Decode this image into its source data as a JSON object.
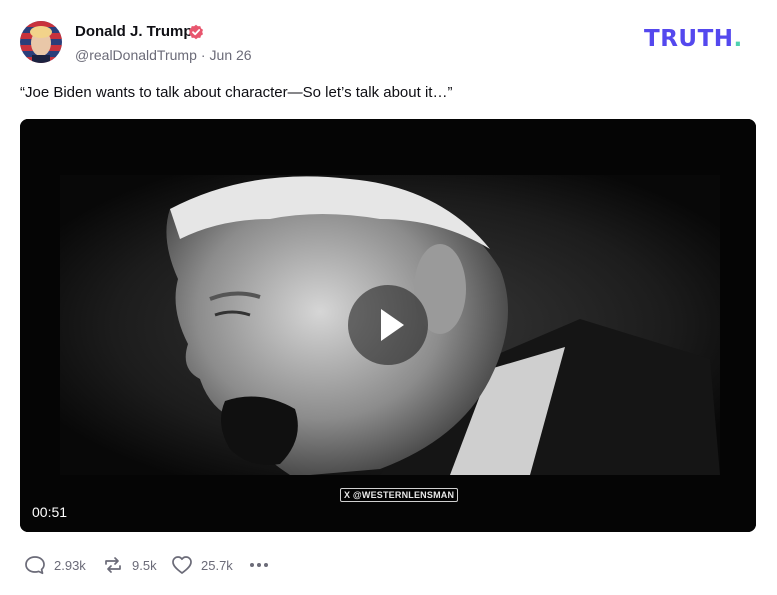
{
  "author": {
    "name": "Donald J. Trump",
    "handle": "@realDonaldTrump",
    "date": "Jun 26",
    "verified": true
  },
  "brand": {
    "text": "TRUTH",
    "dot": "."
  },
  "post": {
    "text": "“Joe Biden wants to talk about character—So let’s talk about it…”"
  },
  "video": {
    "duration": "00:51",
    "watermark": "X @WESTERNLENSMAN"
  },
  "actions": {
    "replies": "2.93k",
    "retruths": "9.5k",
    "likes": "25.7k"
  },
  "colors": {
    "brand": "#5448ee",
    "brand_dot": "#4fd1b0",
    "verified": "#e8566e",
    "muted": "#6b6b78"
  }
}
